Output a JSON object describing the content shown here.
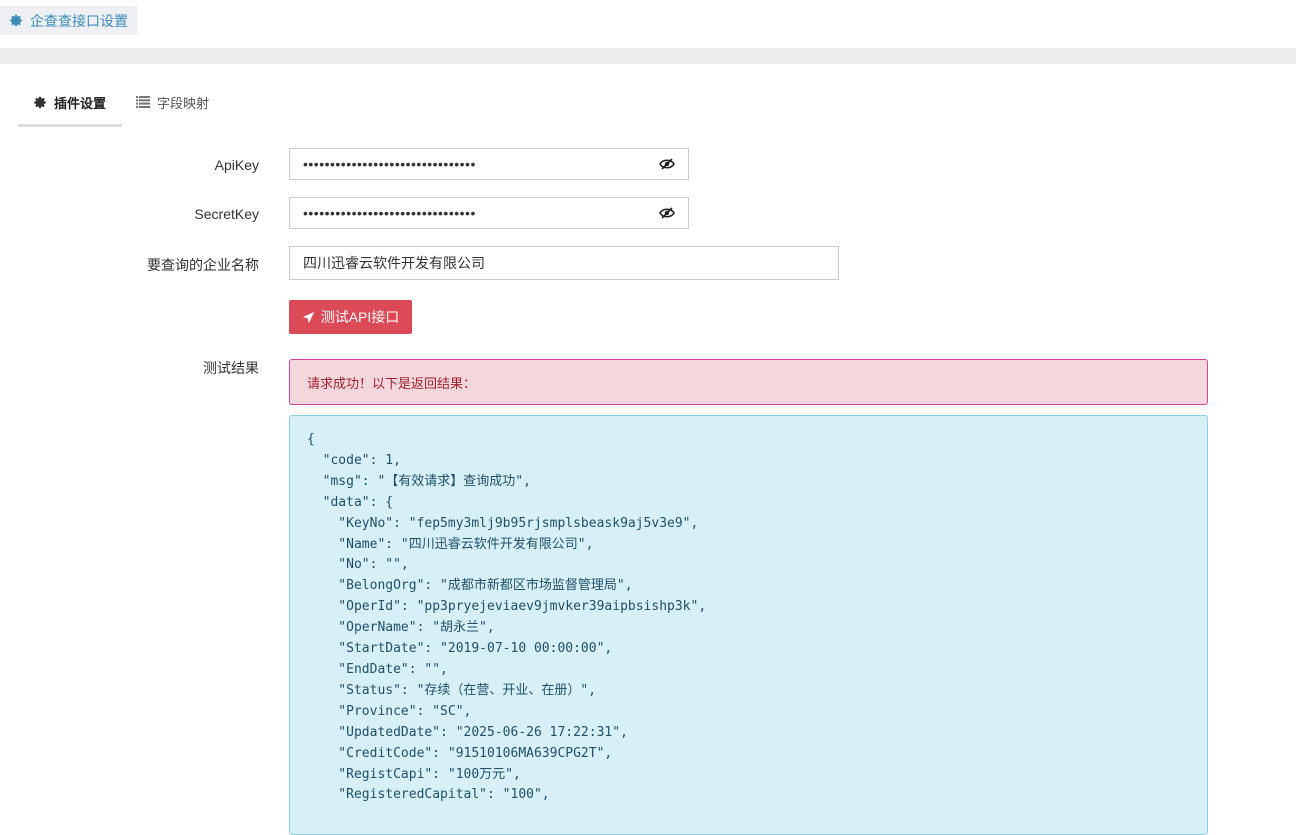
{
  "header": {
    "title": "企查查接口设置",
    "icon": "gear-icon"
  },
  "tabs": [
    {
      "label": "插件设置",
      "icon": "gear-icon",
      "active": true
    },
    {
      "label": "字段映射",
      "icon": "list-icon",
      "active": false
    }
  ],
  "form": {
    "apikey": {
      "label": "ApiKey",
      "value": "••••••••••••••••••••••••••••••••"
    },
    "secretkey": {
      "label": "SecretKey",
      "value": "••••••••••••••••••••••••••••••••"
    },
    "company": {
      "label": "要查询的企业名称",
      "value": "四川迅睿云软件开发有限公司"
    },
    "test_button": "测试API接口",
    "result_label": "测试结果"
  },
  "result": {
    "alert": "请求成功！以下是返回结果：",
    "json_text": "{\n  \"code\": 1,\n  \"msg\": \"【有效请求】查询成功\",\n  \"data\": {\n    \"KeyNo\": \"fep5my3mlj9b95rjsmplsbeask9aj5v3e9\",\n    \"Name\": \"四川迅睿云软件开发有限公司\",\n    \"No\": \"\",\n    \"BelongOrg\": \"成都市新都区市场监督管理局\",\n    \"OperId\": \"pp3pryejeviaev9jmvker39aipbsishp3k\",\n    \"OperName\": \"胡永兰\",\n    \"StartDate\": \"2019-07-10 00:00:00\",\n    \"EndDate\": \"\",\n    \"Status\": \"存续（在营、开业、在册）\",\n    \"Province\": \"SC\",\n    \"UpdatedDate\": \"2025-06-26 17:22:31\",\n    \"CreditCode\": \"91510106MA639CPG2T\",\n    \"RegistCapi\": \"100万元\",\n    \"RegisteredCapital\": \"100\","
  },
  "colors": {
    "accent_blue": "#3c8dbc",
    "button_red": "#dc4a57",
    "alert_bg": "#f4d7dc",
    "code_bg": "#d7f0f8"
  }
}
